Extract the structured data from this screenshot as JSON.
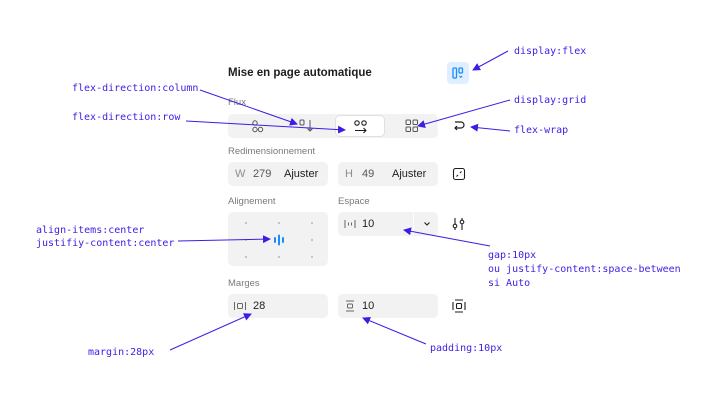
{
  "panel": {
    "title": "Mise en page automatique",
    "flow_label": "Flux",
    "resize_label": "Redimensionnement",
    "align_label": "Alignement",
    "spacing_label": "Espace",
    "margins_label": "Marges"
  },
  "resize": {
    "width_label": "W",
    "width_value": "279",
    "width_mode": "Ajuster",
    "height_label": "H",
    "height_value": "49",
    "height_mode": "Ajuster"
  },
  "spacing": {
    "gap_value": "10"
  },
  "margins": {
    "margin_value": "28",
    "padding_value": "10"
  },
  "annotations": {
    "display_flex": "display:flex",
    "flex_direction_column": "flex-direction:column",
    "display_grid": "display:grid",
    "flex_direction_row": "flex-direction:row",
    "flex_wrap": "flex-wrap",
    "align_items": "align-items:center",
    "justify_content": "justifiy-content:center",
    "gap_line1": "gap:10px",
    "gap_line2": "ou justify-content:space-between",
    "gap_line3": "si Auto",
    "margin": "margin:28px",
    "padding": "padding:10px"
  },
  "colors": {
    "annotation": "#3a1ee6",
    "field_bg": "#f2f2f2",
    "active_icon_bg": "#e0efff",
    "active_icon": "#1a8cff",
    "text": "#1e1e1e",
    "muted": "#7a7a7a"
  },
  "icons": {
    "flex_toggle": "flex-layout-icon",
    "direction_column": "arrow-down-icon",
    "direction_row": "arrow-right-icon",
    "grid": "grid-icon",
    "wrap": "wrap-icon",
    "clip": "clip-content-icon",
    "gap": "gap-icon",
    "chevron": "chevron-down-icon",
    "advanced": "sliders-icon",
    "margin": "margin-icon",
    "padding": "padding-icon",
    "align_center": "align-center-icon",
    "resize_toggle": "resize-toggle-icon"
  }
}
